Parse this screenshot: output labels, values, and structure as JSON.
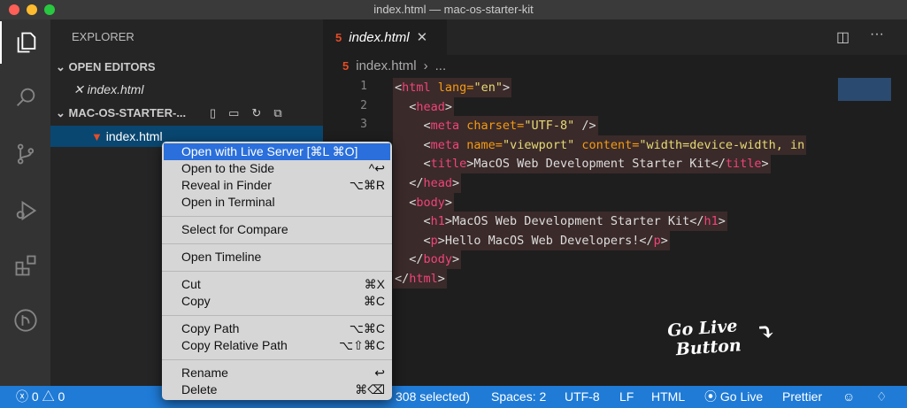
{
  "window": {
    "title": "index.html — mac-os-starter-kit"
  },
  "activity_bar": [
    "explorer-icon",
    "search-icon",
    "source-control-icon",
    "debug-icon",
    "extensions-icon",
    "live-share-icon"
  ],
  "sidebar": {
    "title": "EXPLORER",
    "open_editors": "OPEN EDITORS",
    "open_file": "index.html",
    "folder": "MAC-OS-STARTER-...",
    "file": "index.html"
  },
  "editor": {
    "tab": "index.html",
    "file_badge": "5",
    "breadcrumb_file": "index.html",
    "breadcrumb_more": "...",
    "line_numbers": [
      "1",
      "2",
      "3"
    ],
    "lines": [
      [
        [
          "t",
          "<"
        ],
        [
          "g",
          "html"
        ],
        [
          "a",
          " lang="
        ],
        [
          "s",
          "\"en\""
        ],
        [
          "t",
          ">"
        ]
      ],
      [
        [
          "t",
          "  <"
        ],
        [
          "g",
          "head"
        ],
        [
          "t",
          ">"
        ]
      ],
      [
        [
          "t",
          "    <"
        ],
        [
          "g",
          "meta"
        ],
        [
          "a",
          " charset="
        ],
        [
          "s",
          "\"UTF-8\""
        ],
        [
          "t",
          " />"
        ]
      ],
      [
        [
          "t",
          "    <"
        ],
        [
          "g",
          "meta"
        ],
        [
          "a",
          " name="
        ],
        [
          "s",
          "\"viewport\""
        ],
        [
          "a",
          " content="
        ],
        [
          "s",
          "\"width=device-width, in"
        ]
      ],
      [
        [
          "t",
          "    <"
        ],
        [
          "g",
          "title"
        ],
        [
          "t",
          ">MacOS Web Development Starter Kit</"
        ],
        [
          "g",
          "title"
        ],
        [
          "t",
          ">"
        ]
      ],
      [
        [
          "t",
          "  </"
        ],
        [
          "g",
          "head"
        ],
        [
          "t",
          ">"
        ]
      ],
      [
        [
          "t",
          "  <"
        ],
        [
          "g",
          "body"
        ],
        [
          "t",
          ">"
        ]
      ],
      [
        [
          "t",
          "    <"
        ],
        [
          "g",
          "h1"
        ],
        [
          "t",
          ">MacOS Web Development Starter Kit</"
        ],
        [
          "g",
          "h1"
        ],
        [
          "t",
          ">"
        ]
      ],
      [
        [
          "t",
          "    <"
        ],
        [
          "g",
          "p"
        ],
        [
          "t",
          ">Hello MacOS Web Developers!</"
        ],
        [
          "g",
          "p"
        ],
        [
          "t",
          ">"
        ]
      ],
      [
        [
          "t",
          "  </"
        ],
        [
          "g",
          "body"
        ],
        [
          "t",
          ">"
        ]
      ],
      [
        [
          "t",
          "</"
        ],
        [
          "g",
          "html"
        ],
        [
          "t",
          ">"
        ]
      ]
    ]
  },
  "context_menu": [
    [
      {
        "label": "Open with Live Server [⌘L ⌘O]",
        "shortcut": "",
        "highlight": true
      },
      {
        "label": "Open to the Side",
        "shortcut": "^↩"
      },
      {
        "label": "Reveal in Finder",
        "shortcut": "⌥⌘R"
      },
      {
        "label": "Open in Terminal",
        "shortcut": ""
      }
    ],
    [
      {
        "label": "Select for Compare",
        "shortcut": ""
      }
    ],
    [
      {
        "label": "Open Timeline",
        "shortcut": ""
      }
    ],
    [
      {
        "label": "Cut",
        "shortcut": "⌘X"
      },
      {
        "label": "Copy",
        "shortcut": "⌘C"
      }
    ],
    [
      {
        "label": "Copy Path",
        "shortcut": "⌥⌘C"
      },
      {
        "label": "Copy Relative Path",
        "shortcut": "⌥⇧⌘C"
      }
    ],
    [
      {
        "label": "Rename",
        "shortcut": "↩"
      },
      {
        "label": "Delete",
        "shortcut": "⌘⌫"
      }
    ]
  ],
  "status": {
    "errors": "0",
    "warnings": "0",
    "selection": "308 selected)",
    "spaces": "Spaces: 2",
    "encoding": "UTF-8",
    "eol": "LF",
    "language": "HTML",
    "go_live": "Go Live",
    "prettier": "Prettier"
  },
  "annotation": {
    "line1": "Go Live",
    "line2": "Button"
  }
}
